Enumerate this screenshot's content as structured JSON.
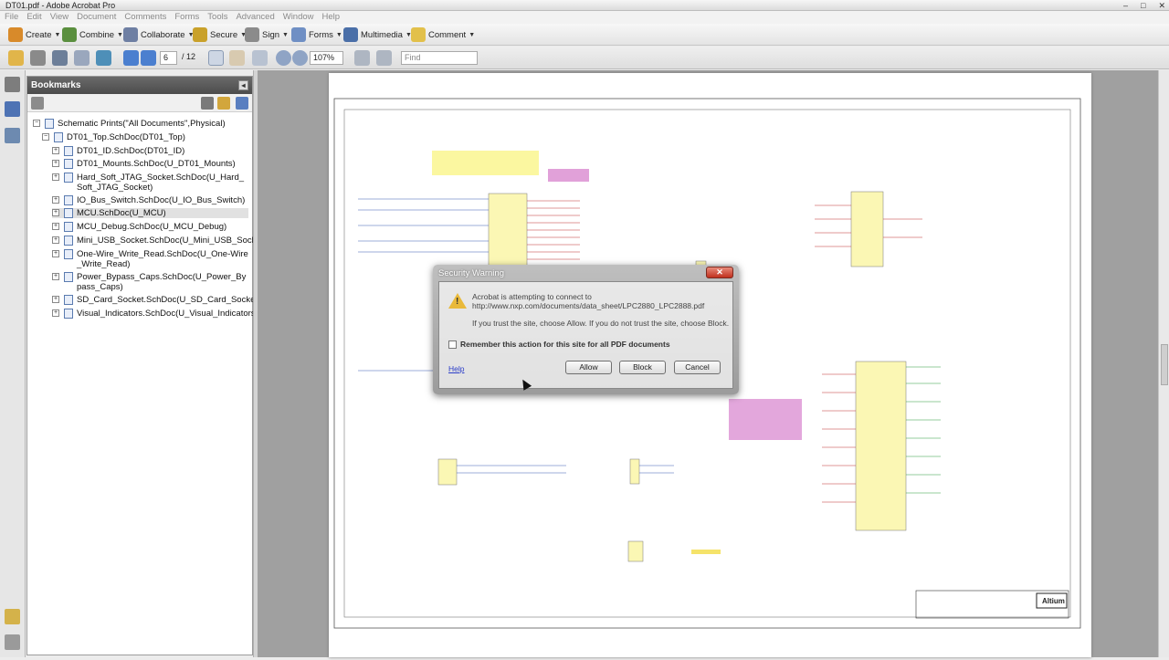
{
  "window": {
    "title": "DT01.pdf - Adobe Acrobat Pro"
  },
  "menu": [
    "File",
    "Edit",
    "View",
    "Document",
    "Comments",
    "Forms",
    "Tools",
    "Advanced",
    "Window",
    "Help"
  ],
  "toolbar": {
    "create": "Create",
    "combine": "Combine",
    "collaborate": "Collaborate",
    "secure": "Secure",
    "sign": "Sign",
    "forms": "Forms",
    "multimedia": "Multimedia",
    "comment": "Comment"
  },
  "nav": {
    "page": "6",
    "total": "/ 12",
    "zoom": "107%",
    "find_placeholder": "Find"
  },
  "bookmarks": {
    "title": "Bookmarks",
    "items": [
      "Schematic Prints(\"All Documents\",Physical)",
      "DT01_Top.SchDoc(DT01_Top)",
      "DT01_ID.SchDoc(DT01_ID)",
      "DT01_Mounts.SchDoc(U_DT01_Mounts)",
      "Hard_Soft_JTAG_Socket.SchDoc(U_Hard_Soft_JTAG_Socket)",
      "IO_Bus_Switch.SchDoc(U_IO_Bus_Switch)",
      "MCU.SchDoc(U_MCU)",
      "MCU_Debug.SchDoc(U_MCU_Debug)",
      "Mini_USB_Socket.SchDoc(U_Mini_USB_Socket)",
      "One-Wire_Write_Read.SchDoc(U_One-Wire_Write_Read)",
      "Power_Bypass_Caps.SchDoc(U_Power_Bypass_Caps)",
      "SD_Card_Socket.SchDoc(U_SD_Card_Socket)",
      "Visual_Indicators.SchDoc(U_Visual_Indicators)"
    ]
  },
  "dialog": {
    "title": "Security Warning",
    "line1": "Acrobat is attempting to connect to",
    "line2": "http://www.nxp.com/documents/data_sheet/LPC2880_LPC2888.pdf",
    "line3": "If you trust the site, choose Allow. If you do not trust the site, choose Block.",
    "remember": "Remember this action for this site for all PDF documents",
    "help": "Help",
    "allow": "Allow",
    "block": "Block",
    "cancel": "Cancel"
  }
}
